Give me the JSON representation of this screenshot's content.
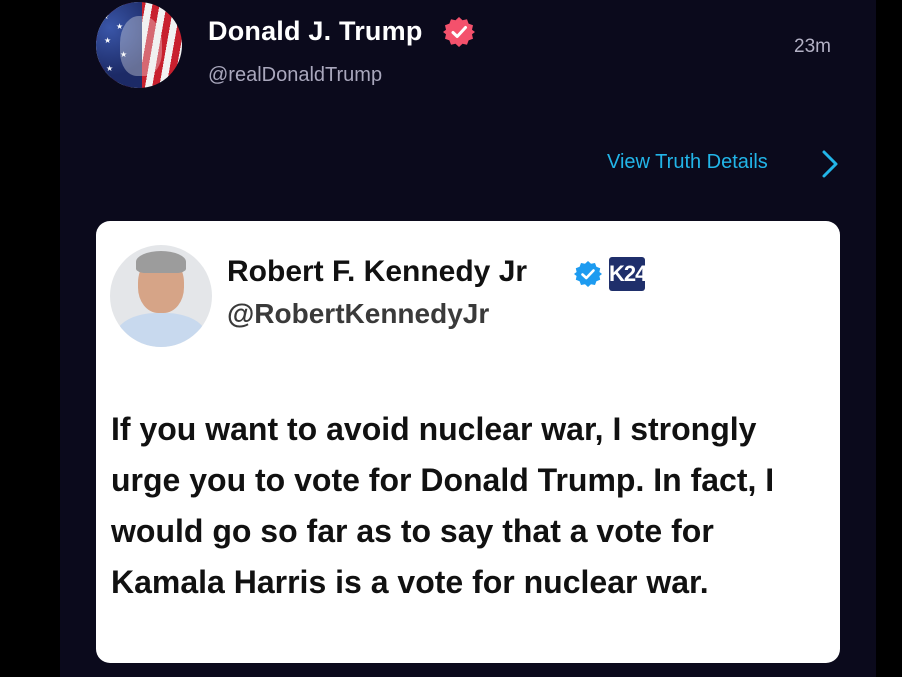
{
  "post": {
    "author_name": "Donald J. Trump",
    "author_handle": "@realDonaldTrump",
    "timestamp": "23m",
    "view_details_label": "View Truth Details"
  },
  "quoted": {
    "author_name": "Robert F. Kennedy Jr",
    "author_handle": "@RobertKennedyJr",
    "badge_text": "K24",
    "text": "If you want to avoid nuclear war, I strongly urge you to vote for Donald Trump. In fact, I would go so far as to say that a vote for Kamala Harris is a vote for nuclear war."
  },
  "icons": {
    "verified": "verified-badge-icon",
    "chevron": "chevron-right-icon"
  },
  "colors": {
    "background": "#0b0a1c",
    "link": "#22b5e8",
    "truth_verified": "#f4516c",
    "x_verified": "#1d9bf0",
    "card": "#ffffff"
  }
}
